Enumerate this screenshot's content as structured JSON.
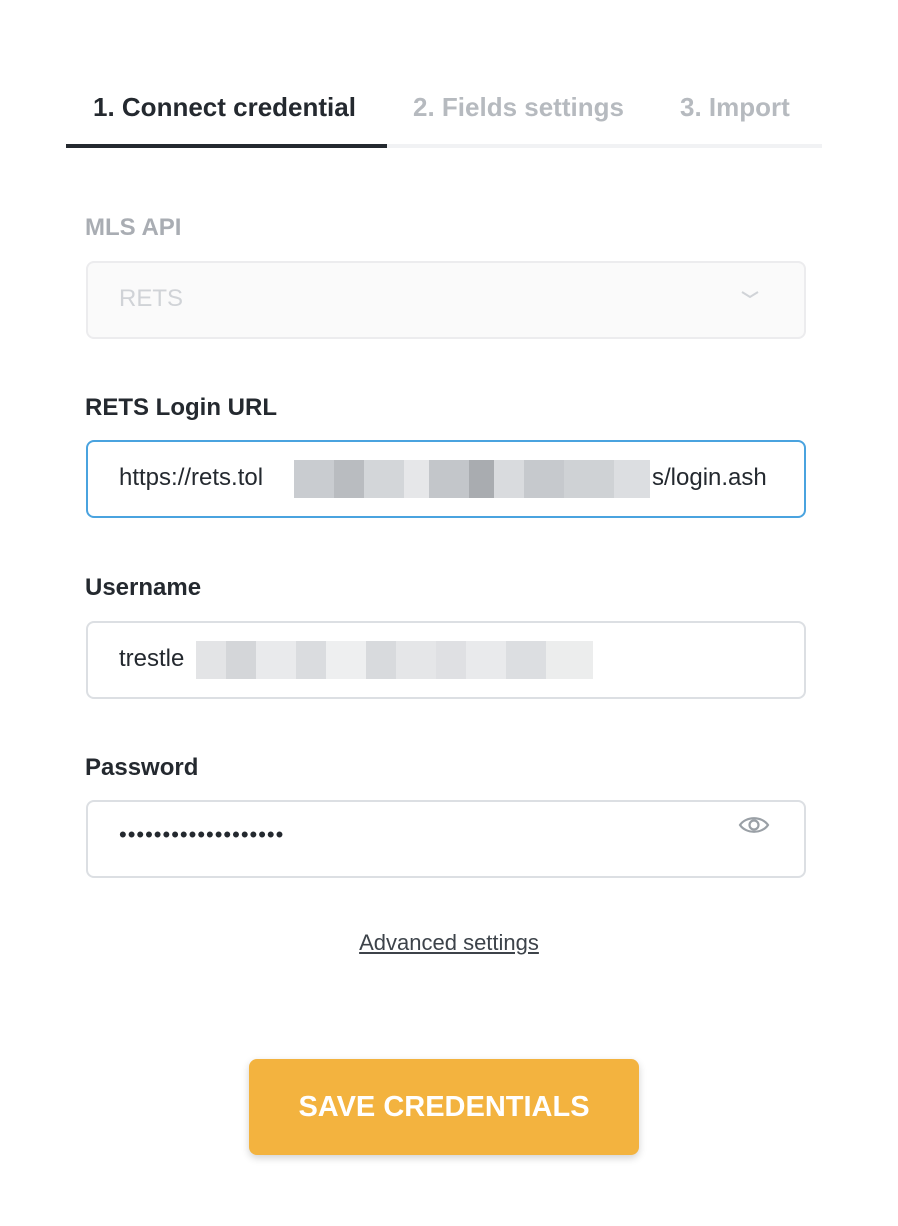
{
  "tabs": [
    {
      "label": "1. Connect credential",
      "active": true
    },
    {
      "label": "2. Fields settings",
      "active": false
    },
    {
      "label": "3. Import",
      "active": false
    }
  ],
  "form": {
    "mls_api": {
      "label": "MLS API",
      "value": "RETS",
      "disabled": true
    },
    "rets_login_url": {
      "label": "RETS Login URL",
      "value_prefix": "https://rets.tol",
      "value_suffix": "s/login.ash"
    },
    "username": {
      "label": "Username",
      "value_prefix": "trestle"
    },
    "password": {
      "label": "Password",
      "value": "•••••••••••••••••••"
    }
  },
  "advanced_link": "Advanced settings",
  "save_button": "SAVE CREDENTIALS",
  "colors": {
    "accent": "#f3b33f",
    "focus": "#4aa3df",
    "text": "#24292f",
    "muted": "#b6babf"
  },
  "icons": {
    "dropdown": "chevron-down-icon",
    "password_toggle": "eye-icon"
  }
}
